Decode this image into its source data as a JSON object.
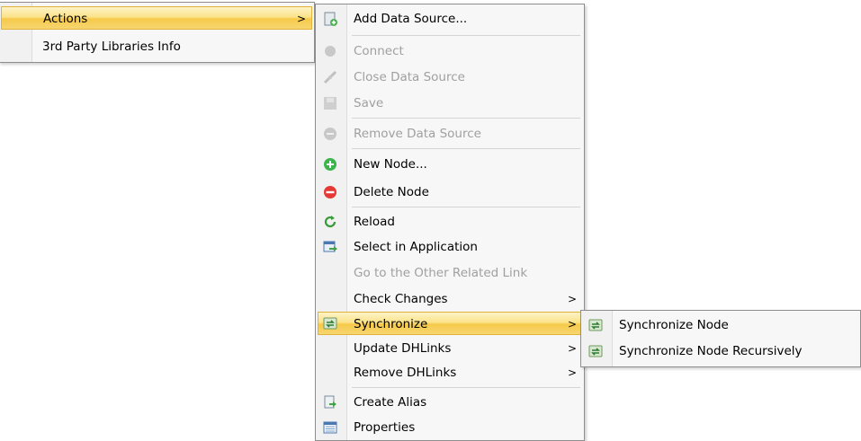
{
  "root_menu": {
    "items": [
      {
        "label": "Actions",
        "has_submenu": true,
        "highlighted": true
      },
      {
        "label": "3rd Party Libraries Info"
      }
    ]
  },
  "actions_menu": {
    "items": [
      {
        "label": "Add Data Source...",
        "icon": "add-data-source-icon"
      },
      {
        "label": "Connect",
        "icon": "connect-icon",
        "disabled": true
      },
      {
        "label": "Close Data Source",
        "icon": "disconnect-icon",
        "disabled": true
      },
      {
        "label": "Save",
        "icon": "save-icon",
        "disabled": true
      },
      {
        "label": "Remove Data Source",
        "icon": "remove-icon",
        "disabled": true
      },
      {
        "label": "New Node...",
        "icon": "plus-green-icon"
      },
      {
        "label": "Delete Node",
        "icon": "minus-red-icon"
      },
      {
        "label": "Reload",
        "icon": "reload-icon"
      },
      {
        "label": "Select in Application",
        "icon": "select-app-icon"
      },
      {
        "label": "Go to the Other Related Link",
        "disabled": true
      },
      {
        "label": "Check Changes",
        "has_submenu": true
      },
      {
        "label": "Synchronize",
        "icon": "sync-icon",
        "has_submenu": true,
        "highlighted": true
      },
      {
        "label": "Update DHLinks",
        "has_submenu": true
      },
      {
        "label": "Remove DHLinks",
        "has_submenu": true
      },
      {
        "label": "Create Alias",
        "icon": "alias-icon"
      },
      {
        "label": "Properties",
        "icon": "properties-icon"
      }
    ]
  },
  "synchronize_menu": {
    "items": [
      {
        "label": "Synchronize Node",
        "icon": "sync-icon"
      },
      {
        "label": "Synchronize Node Recursively",
        "icon": "sync-icon"
      }
    ]
  },
  "submenu_arrow": ">",
  "colors": {
    "highlight_top": "#fdf3c7",
    "highlight_bottom": "#f6c94a",
    "disabled_text": "#a0a0a0",
    "menu_bg": "#f7f7f7"
  }
}
